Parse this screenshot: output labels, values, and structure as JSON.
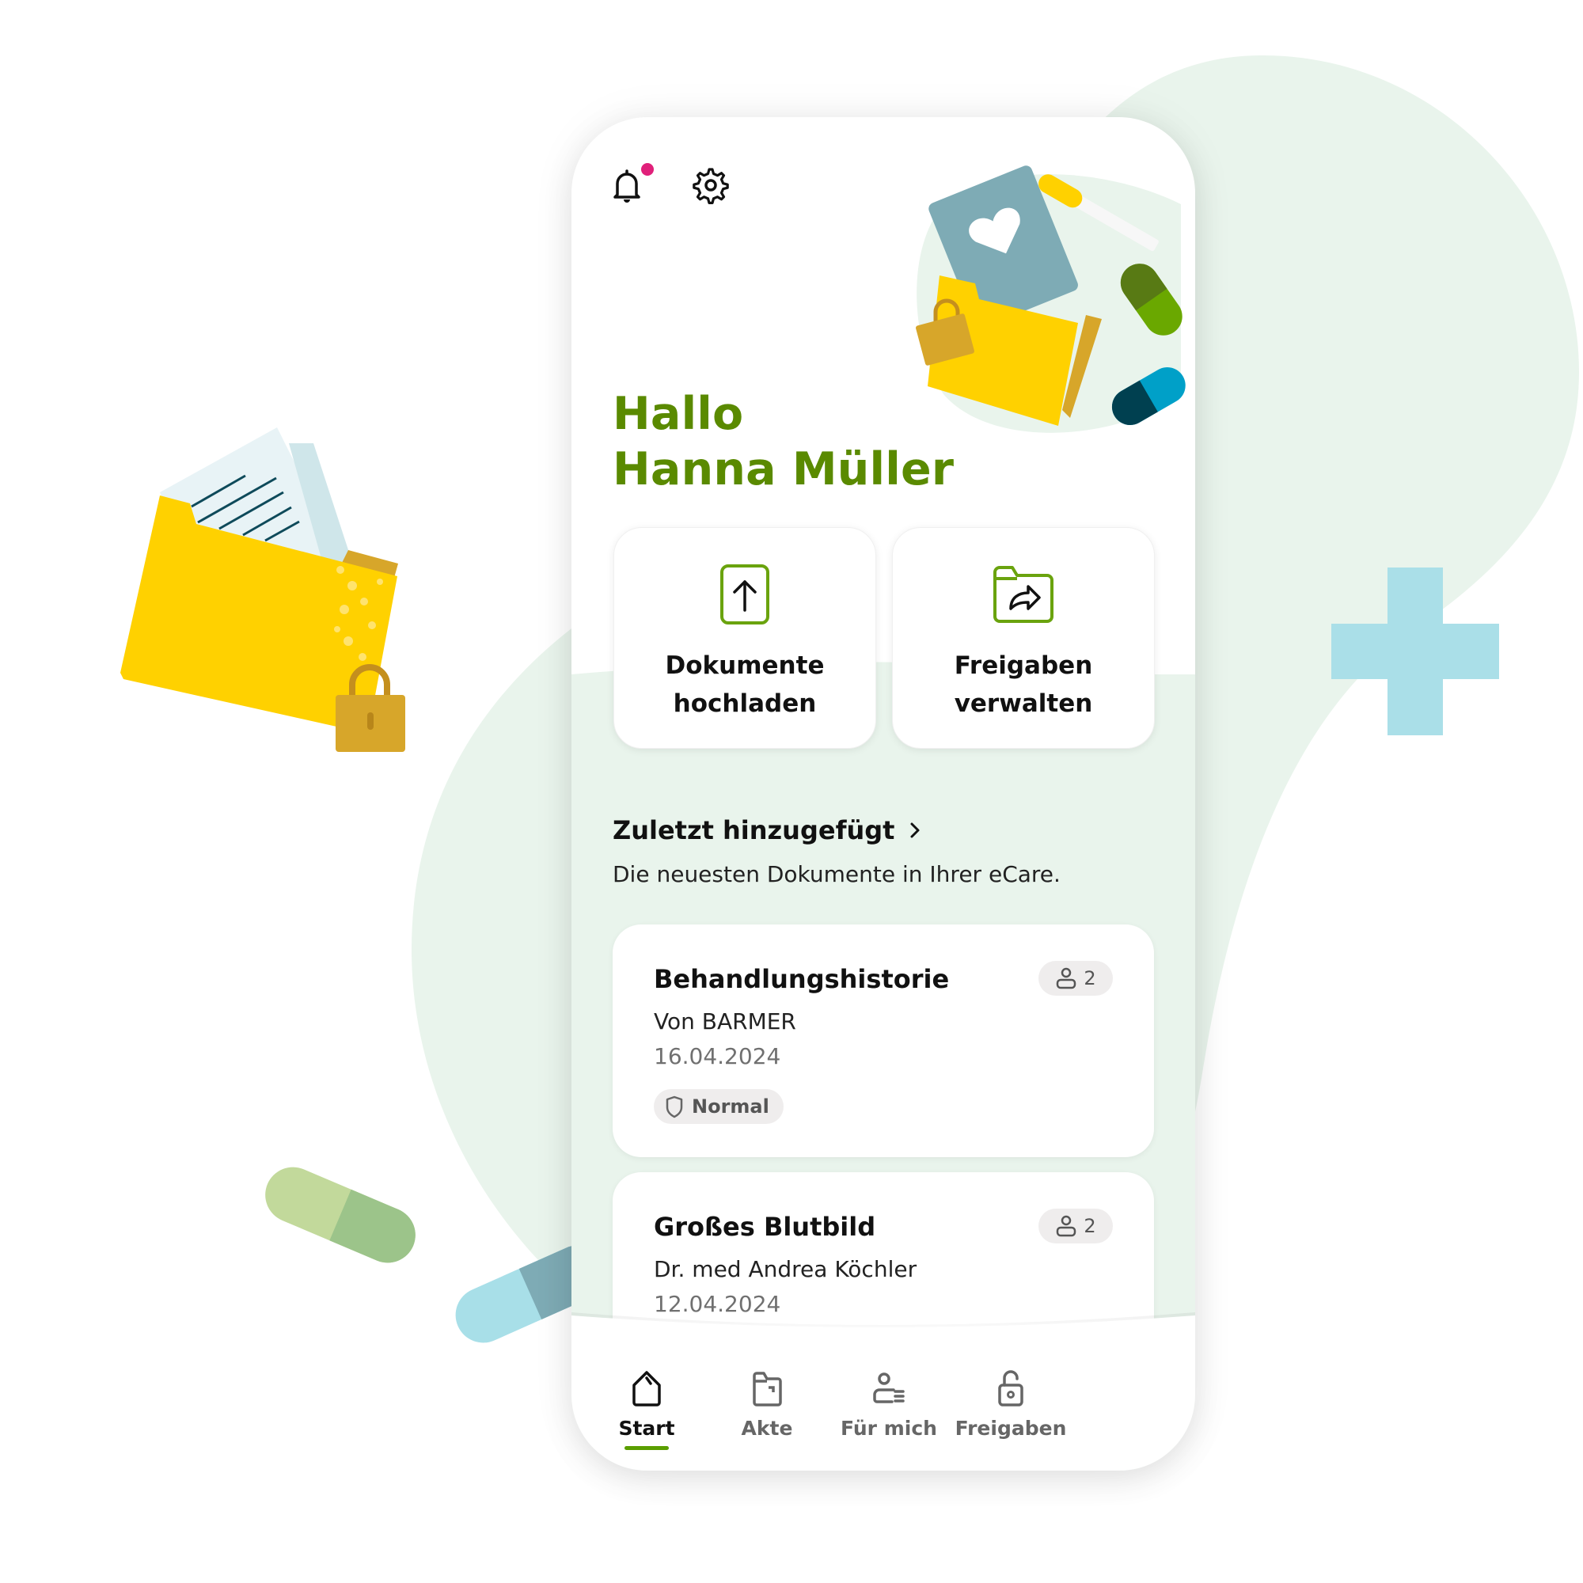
{
  "header": {
    "notifications_icon": "bell-icon",
    "has_unread_notification": true,
    "settings_icon": "gear-icon"
  },
  "greeting": {
    "line1": "Hallo",
    "line2": "Hanna Müller"
  },
  "quick_actions": [
    {
      "icon": "upload-document-icon",
      "line1": "Dokumente",
      "line2": "hochladen"
    },
    {
      "icon": "folder-share-icon",
      "line1": "Freigaben",
      "line2": "verwalten"
    }
  ],
  "recent": {
    "title": "Zuletzt hinzugefügt",
    "chevron_icon": "chevron-right-icon",
    "subtitle": "Die neuesten Dokumente in Ihrer eCare."
  },
  "documents": [
    {
      "title": "Behandlungshistorie",
      "from": "Von BARMER",
      "date": "16.04.2024",
      "shared_count": "2",
      "security_label": "Normal"
    },
    {
      "title": "Großes Blutbild",
      "from": "Dr. med Andrea Köchler",
      "date": "12.04.2024",
      "shared_count": "2"
    }
  ],
  "bottom_nav": {
    "items": [
      {
        "label": "Start",
        "icon": "home-icon",
        "active": true
      },
      {
        "label": "Akte",
        "icon": "folder-icon",
        "active": false
      },
      {
        "label": "Für mich",
        "icon": "person-list-icon",
        "active": false
      },
      {
        "label": "Freigaben",
        "icon": "unlock-icon",
        "active": false
      }
    ]
  },
  "colors": {
    "accent_green": "#5a8a00",
    "nav_active_underline": "#5a9e00",
    "notification_dot": "#e0207a",
    "section_bg": "#e9f4ec",
    "icon_green": "#6aa30e"
  }
}
